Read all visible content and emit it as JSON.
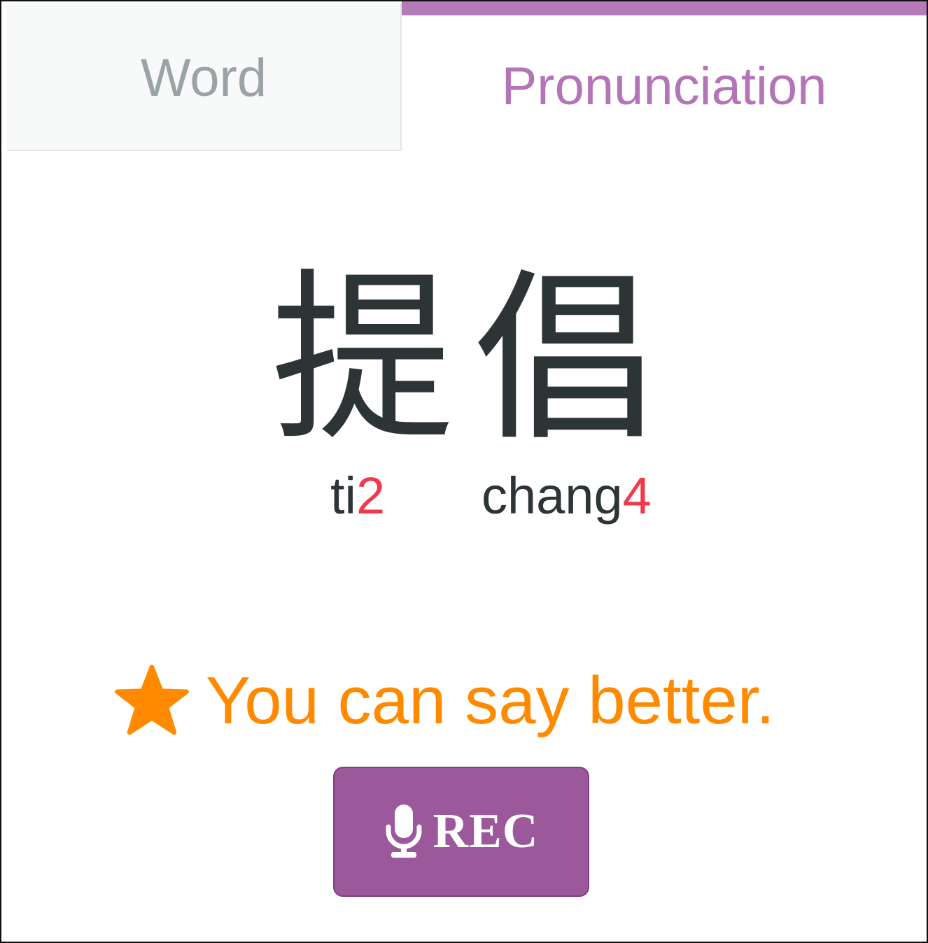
{
  "tabs": [
    {
      "label": "Word",
      "active": false
    },
    {
      "label": "Pronunciation",
      "active": true
    }
  ],
  "word": {
    "characters": [
      "提",
      "倡"
    ],
    "pinyin": [
      {
        "syllable": "ti",
        "tone": "2"
      },
      {
        "syllable": "chang",
        "tone": "4"
      }
    ]
  },
  "feedback": {
    "icon": "star-icon",
    "text": "You can say better."
  },
  "rec_button": {
    "icon": "microphone-icon",
    "label": "REC"
  },
  "colors": {
    "accent": "#b474b8",
    "feedback": "#ff8a00",
    "tone": "#ee3a4a",
    "button": "#9b589b",
    "text": "#2d3436"
  }
}
